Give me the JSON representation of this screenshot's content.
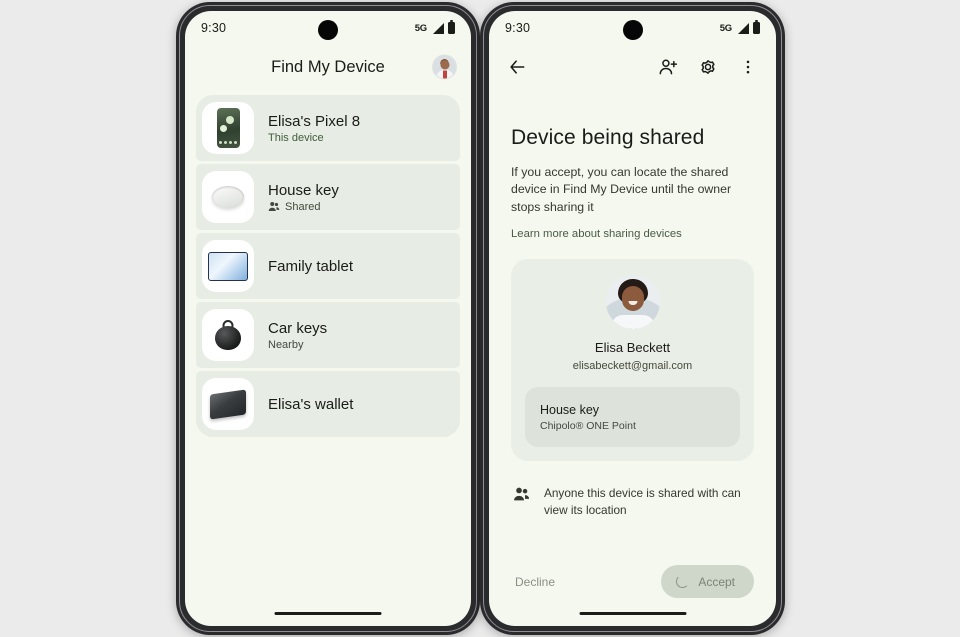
{
  "page": {
    "background_color": "#ebebeb",
    "screen_background": "#f4f8ef",
    "card_color": "#e7ece4",
    "accent_text": "#4a5a45"
  },
  "left_phone": {
    "status_bar": {
      "clock": "9:30",
      "network": "5G",
      "signal_icon": "signal-bars-icon",
      "battery_icon": "battery-full-icon"
    },
    "app_bar": {
      "title": "Find My Device",
      "avatar_name": "account-avatar"
    },
    "devices": [
      {
        "name": "Elisa's Pixel 8",
        "subtitle": "This device",
        "subtitle_style": "green",
        "thumb": "pixel-phone-thumb",
        "badge_icon": ""
      },
      {
        "name": "House key",
        "subtitle": "Shared",
        "subtitle_style": "plain",
        "thumb": "chipolo-tracker-thumb",
        "badge_icon": "people-icon"
      },
      {
        "name": "Family tablet",
        "subtitle": "",
        "subtitle_style": "plain",
        "thumb": "tablet-thumb",
        "badge_icon": ""
      },
      {
        "name": "Car keys",
        "subtitle": "Nearby",
        "subtitle_style": "plain",
        "thumb": "key-tag-thumb",
        "badge_icon": ""
      },
      {
        "name": "Elisa's wallet",
        "subtitle": "",
        "subtitle_style": "plain",
        "thumb": "wallet-thumb",
        "badge_icon": ""
      }
    ]
  },
  "right_phone": {
    "status_bar": {
      "clock": "9:30",
      "network": "5G",
      "signal_icon": "signal-bars-icon",
      "battery_icon": "battery-full-icon"
    },
    "top_bar": {
      "back_icon": "arrow-back-icon",
      "add_person_icon": "person-add-icon",
      "settings_icon": "gear-icon",
      "overflow_icon": "more-vert-icon"
    },
    "title": "Device being shared",
    "description": "If you accept, you can locate the shared device in Find My Device until the owner stops sharing it",
    "learn_more_link": "Learn more about sharing devices",
    "share_card": {
      "avatar_name": "elisa-beckett-avatar",
      "person_name": "Elisa Beckett",
      "person_email": "elisabeckett@gmail.com",
      "device": {
        "name": "House key",
        "model": "Chipolo® ONE Point",
        "thumb": "chipolo-tracker-thumb"
      }
    },
    "note": {
      "icon": "people-icon",
      "text": "Anyone this device is shared with can view its location"
    },
    "actions": {
      "decline_label": "Decline",
      "accept_label": "Accept",
      "accept_spinner_icon": "loading-spinner-icon",
      "accept_disabled": true
    }
  }
}
